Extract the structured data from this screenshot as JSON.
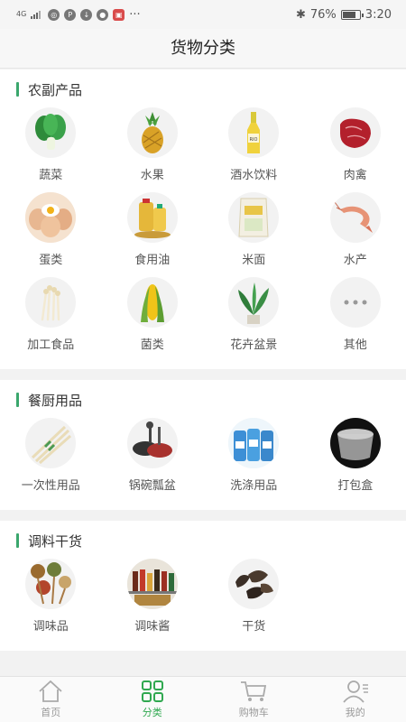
{
  "status_bar": {
    "network": "4G",
    "battery": "76%",
    "time": "3:20",
    "more": "···"
  },
  "header": {
    "title": "货物分类"
  },
  "sections": [
    {
      "title": "农副产品",
      "items": [
        {
          "label": "蔬菜",
          "icon": "vegetable-icon"
        },
        {
          "label": "水果",
          "icon": "pineapple-icon"
        },
        {
          "label": "酒水饮料",
          "icon": "beverage-bottle-icon"
        },
        {
          "label": "肉禽",
          "icon": "meat-icon"
        },
        {
          "label": "蛋类",
          "icon": "eggs-icon"
        },
        {
          "label": "食用油",
          "icon": "cooking-oil-icon"
        },
        {
          "label": "米面",
          "icon": "rice-bag-icon"
        },
        {
          "label": "水产",
          "icon": "shrimp-icon"
        },
        {
          "label": "加工食品",
          "icon": "mushroom-icon"
        },
        {
          "label": "菌类",
          "icon": "corn-icon"
        },
        {
          "label": "花卉盆景",
          "icon": "potted-plant-icon"
        },
        {
          "label": "其他",
          "icon": "more-dots-icon"
        }
      ]
    },
    {
      "title": "餐厨用品",
      "items": [
        {
          "label": "一次性用品",
          "icon": "chopsticks-icon"
        },
        {
          "label": "锅碗瓢盆",
          "icon": "cookware-icon"
        },
        {
          "label": "洗涤用品",
          "icon": "detergent-bottles-icon"
        },
        {
          "label": "打包盒",
          "icon": "takeout-box-icon"
        }
      ]
    },
    {
      "title": "调料干货",
      "items": [
        {
          "label": "调味品",
          "icon": "spice-spoons-icon"
        },
        {
          "label": "调味酱",
          "icon": "sauce-shelf-icon"
        },
        {
          "label": "干货",
          "icon": "dried-fungus-icon"
        }
      ]
    }
  ],
  "tabbar": {
    "tabs": [
      {
        "label": "首页",
        "icon": "home-icon"
      },
      {
        "label": "分类",
        "icon": "grid-icon",
        "active": true
      },
      {
        "label": "购物车",
        "icon": "cart-icon"
      },
      {
        "label": "我的",
        "icon": "user-icon"
      }
    ]
  },
  "colors": {
    "accent": "#3aa76d",
    "active_tab": "#2fa84f"
  }
}
